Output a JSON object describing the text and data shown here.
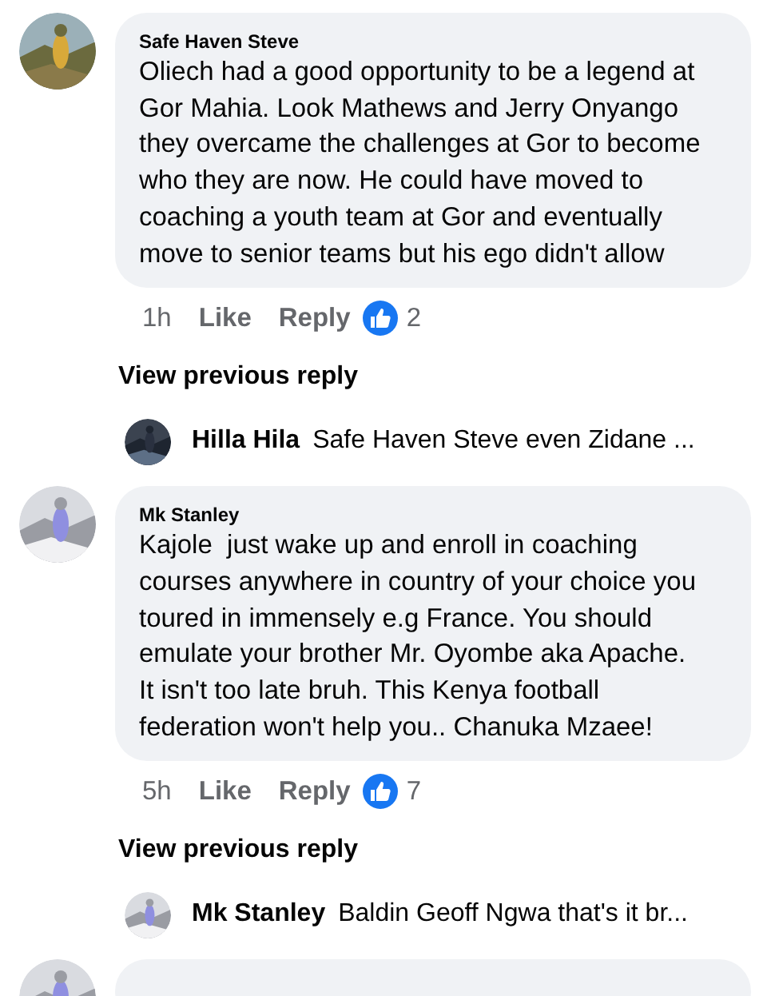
{
  "comments": [
    {
      "author": "Safe Haven Steve",
      "text": "Oliech had a good opportunity to be a legend at Gor Mahia. Look Mathews and Jerry Onyango they overcame the challenges at Gor to become who they are now. He could have moved to coaching a youth team at Gor and eventually move to senior teams but his ego didn't allow",
      "time": "1h",
      "actions": [
        "Like",
        "Reply"
      ],
      "reaction_count": "2",
      "view_previous": "View previous reply",
      "reply": {
        "author": "Hilla Hila",
        "text": "Safe Haven Steve even Zidane ..."
      }
    },
    {
      "author": "Mk Stanley",
      "text": "Kajole  just wake up and enroll in coaching courses anywhere in country of your choice you toured in immensely e.g France. You should emulate your brother Mr. Oyombe aka Apache. It isn't too late bruh. This Kenya football federation won't help you.. Chanuka Mzaee!",
      "time": "5h",
      "actions": [
        "Like",
        "Reply"
      ],
      "reaction_count": "7",
      "view_previous": "View previous reply",
      "reply": {
        "author": "Mk Stanley",
        "text": "Baldin Geoff Ngwa that's it br..."
      }
    }
  ]
}
